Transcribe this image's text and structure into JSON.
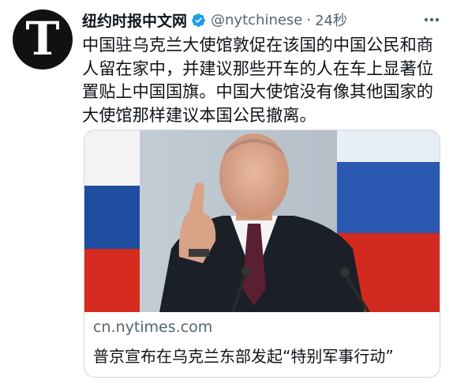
{
  "tweet": {
    "author_name": "纽约时报中文网",
    "verified_icon": "verified-badge-icon",
    "handle": "@nytchinese",
    "separator": "·",
    "time": "24秒",
    "avatar_letter": "T",
    "text": "中国驻乌克兰大使馆敦促在该国的中国公民和商人留在家中，并建议那些开车的人在车上显著位置贴上中国国旗。中国大使馆没有像其他国家的大使馆那样建议本国公民撤离。"
  },
  "card": {
    "image_description_icon": "news-photo",
    "domain": "cn.nytimes.com",
    "title": "普京宣布在乌克兰东部发起“特别军事行动”"
  },
  "colors": {
    "verified_blue": "#1d9bf0",
    "secondary_text": "#536471",
    "border": "#cfd9de"
  }
}
